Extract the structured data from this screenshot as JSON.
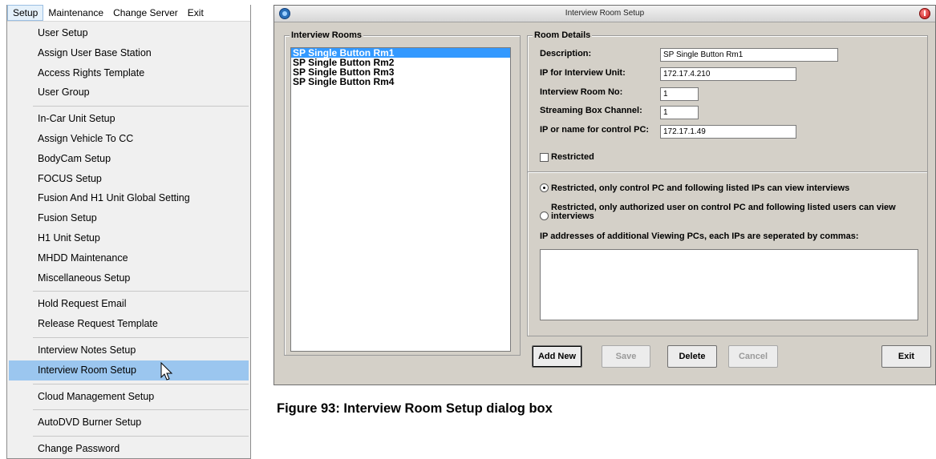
{
  "menubar": {
    "items": [
      "Setup",
      "Maintenance",
      "Change Server",
      "Exit"
    ]
  },
  "menu": {
    "group1": [
      "User Setup",
      "Assign User Base Station",
      "Access Rights Template",
      "User Group"
    ],
    "group2": [
      "In-Car Unit Setup",
      "Assign Vehicle To CC",
      "BodyCam Setup",
      "FOCUS Setup",
      "Fusion And H1 Unit Global Setting",
      "Fusion Setup",
      "H1 Unit Setup",
      "MHDD Maintenance",
      "Miscellaneous Setup"
    ],
    "group3": [
      "Hold Request Email",
      "Release Request Template"
    ],
    "group4": [
      "Interview Notes Setup",
      "Interview Room Setup"
    ],
    "group5": [
      "Cloud Management Setup"
    ],
    "group6": [
      "AutoDVD Burner Setup"
    ],
    "group7": [
      "Change Password"
    ],
    "highlighted": "Interview Room Setup",
    "highlight_color": "#9bc6ef"
  },
  "dialog": {
    "title": "Interview Room Setup",
    "rooms": {
      "label": "Interview Rooms",
      "items": [
        "SP Single Button Rm1",
        "SP Single Button Rm2",
        "SP Single Button Rm3",
        "SP Single Button Rm4"
      ],
      "selected": "SP Single Button Rm1",
      "selection_color": "#3399ff"
    },
    "details": {
      "label": "Room Details",
      "description_label": "Description:",
      "description_value": "SP Single Button Rm1",
      "ip_unit_label": "IP for Interview Unit:",
      "ip_unit_value": "172.17.4.210",
      "room_no_label": "Interview Room No:",
      "room_no_value": "1",
      "channel_label": "Streaming Box Channel:",
      "channel_value": "1",
      "control_pc_label": "IP or name for control PC:",
      "control_pc_value": "172.17.1.49",
      "restricted_label": "Restricted",
      "restricted_checked": false,
      "option1": "Restricted, only control PC and following listed IPs can view interviews",
      "option1_selected": true,
      "option2_line1": "Restricted, only authorized user on control PC and following listed users can view",
      "option2_line2": "interviews",
      "option2_selected": false,
      "viewing_ips_label": "IP addresses of additional Viewing PCs, each IPs are seperated by commas:",
      "viewing_ips_value": ""
    },
    "buttons": {
      "add_new": "Add New",
      "save": "Save",
      "delete": "Delete",
      "cancel": "Cancel",
      "exit": "Exit"
    }
  },
  "caption": "Figure 93: Interview Room Setup dialog box"
}
